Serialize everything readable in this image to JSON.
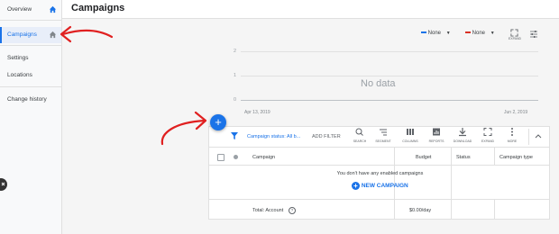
{
  "sidebar": {
    "items": [
      {
        "label": "Overview"
      },
      {
        "label": "Campaigns"
      },
      {
        "label": "Settings"
      },
      {
        "label": "Locations"
      },
      {
        "label": "Change history"
      }
    ]
  },
  "header": {
    "title": "Campaigns"
  },
  "controls": {
    "metric1": "None",
    "metric2": "None",
    "expand_label": "EXPAND",
    "accent_color": "#1a73e8",
    "metric2_color": "#d93025"
  },
  "chart": {
    "y_ticks": [
      "2",
      "1",
      "0"
    ],
    "no_data": "No data",
    "date_start": "Apr 13, 2019",
    "date_end": "Jun 2, 2019"
  },
  "toolbar": {
    "filter_status": "Campaign status: All b...",
    "add_filter": "ADD FILTER",
    "icons": [
      "SEARCH",
      "SEGMENT",
      "COLUMNS",
      "REPORTS",
      "DOWNLOAD",
      "EXPAND",
      "MORE"
    ]
  },
  "table": {
    "headers": {
      "campaign": "Campaign",
      "budget": "Budget",
      "status": "Status",
      "type": "Campaign type"
    },
    "empty_message": "You don't have any enabled campaigns",
    "new_campaign": "NEW CAMPAIGN",
    "footer_label": "Total: Account",
    "footer_budget": "$0.00/day"
  }
}
